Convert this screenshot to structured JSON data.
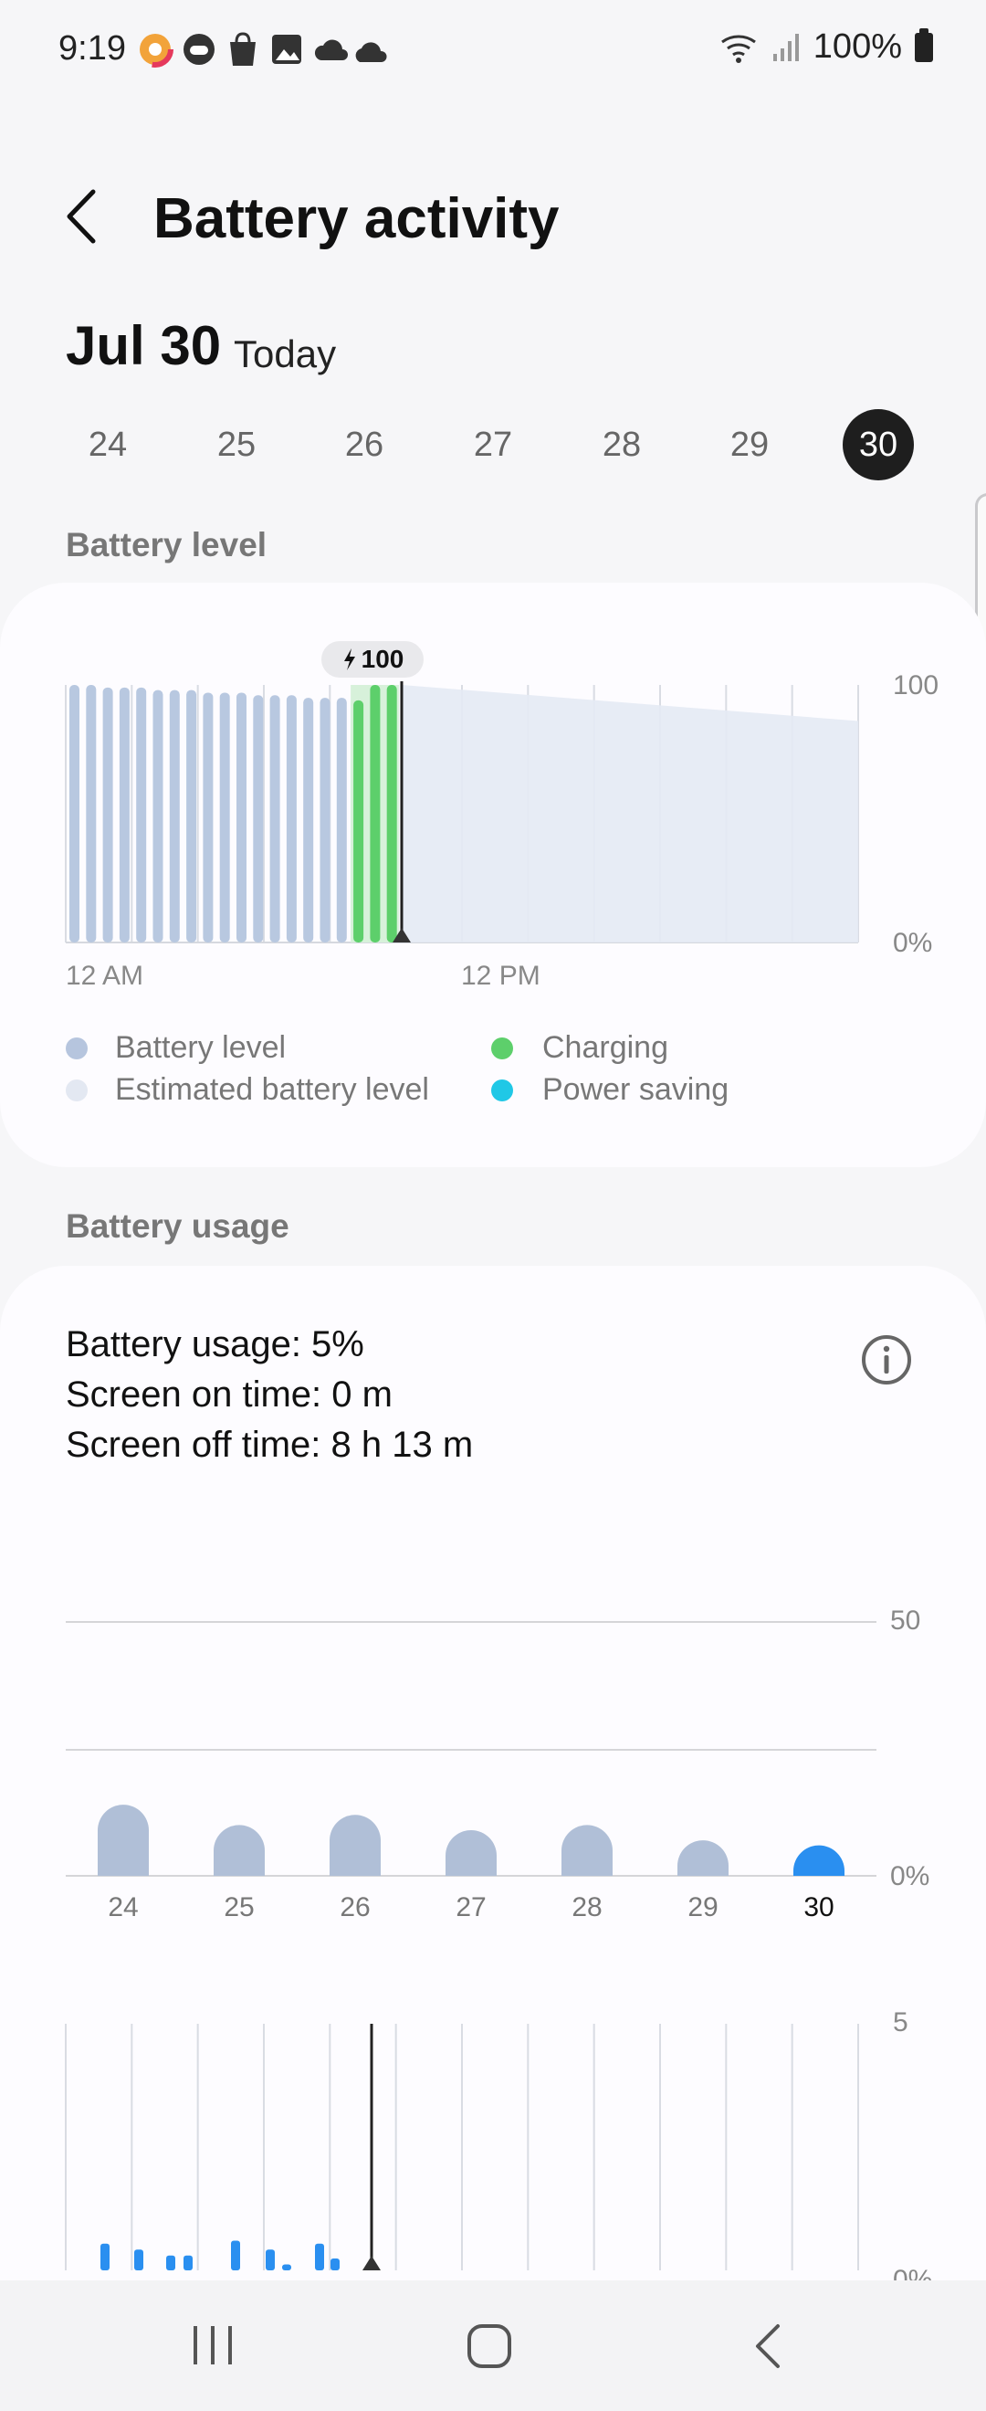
{
  "status_bar": {
    "time": "9:19",
    "battery_percent": "100%",
    "notification_icons": [
      "browser-app-icon",
      "game-controller-icon",
      "shopping-bag-icon",
      "gallery-icon",
      "cloud-sync-icon",
      "cloud-icon"
    ]
  },
  "header": {
    "title": "Battery activity"
  },
  "date": {
    "main": "Jul 30",
    "sub": "Today"
  },
  "day_selector": {
    "days": [
      "24",
      "25",
      "26",
      "27",
      "28",
      "29",
      "30"
    ],
    "selected": "30"
  },
  "battery_level": {
    "section_label": "Battery level",
    "charge_badge": "100",
    "y_max_label": "100",
    "y_min_label": "0%",
    "x_labels": [
      "12 AM",
      "12 PM"
    ],
    "legend": [
      {
        "label": "Battery level",
        "color": "#b6c5de"
      },
      {
        "label": "Estimated battery level",
        "color": "#e3e8f2"
      },
      {
        "label": "Charging",
        "color": "#5dcf6b"
      },
      {
        "label": "Power saving",
        "color": "#20c8e6"
      }
    ],
    "colors": {
      "level": "#b8c8e0",
      "charging": "#5dcf6b",
      "estimated": "#e4eaf4"
    }
  },
  "battery_usage": {
    "section_label": "Battery usage",
    "usage_line": "Battery usage: 5%",
    "screen_on": "Screen on time: 0 m",
    "screen_off": "Screen off time: 8 h 13 m",
    "daily_chart": {
      "y_max_label": "50",
      "y_min_label": "0%",
      "days": [
        "24",
        "25",
        "26",
        "27",
        "28",
        "29",
        "30"
      ],
      "selected": "30"
    },
    "hourly_chart": {
      "y_max_label": "5",
      "y_min_label": "0%"
    }
  },
  "chart_data": [
    {
      "type": "bar",
      "title": "Battery level",
      "x_labels_shown": [
        "12 AM",
        "12 PM"
      ],
      "ylim": [
        0,
        100
      ],
      "series": [
        {
          "name": "Battery level",
          "values": [
            100,
            100,
            99,
            99,
            99,
            98,
            98,
            98,
            97,
            97,
            97,
            96,
            96,
            96,
            95,
            95,
            95
          ]
        },
        {
          "name": "Charging",
          "values": [
            94,
            100,
            100
          ]
        },
        {
          "name": "Estimated battery level",
          "values": [
            100,
            86
          ]
        }
      ]
    },
    {
      "type": "bar",
      "title": "Battery usage by day",
      "categories": [
        "24",
        "25",
        "26",
        "27",
        "28",
        "29",
        "30"
      ],
      "values": [
        14,
        10,
        12,
        9,
        10,
        7,
        6
      ],
      "ylim": [
        0,
        50
      ]
    },
    {
      "type": "bar",
      "title": "Battery usage by hour",
      "values": [
        0.9,
        0.7,
        0.5,
        0.5,
        1.0,
        0.7,
        0.2,
        0.9,
        0.4
      ],
      "ylim": [
        0,
        5
      ]
    }
  ]
}
